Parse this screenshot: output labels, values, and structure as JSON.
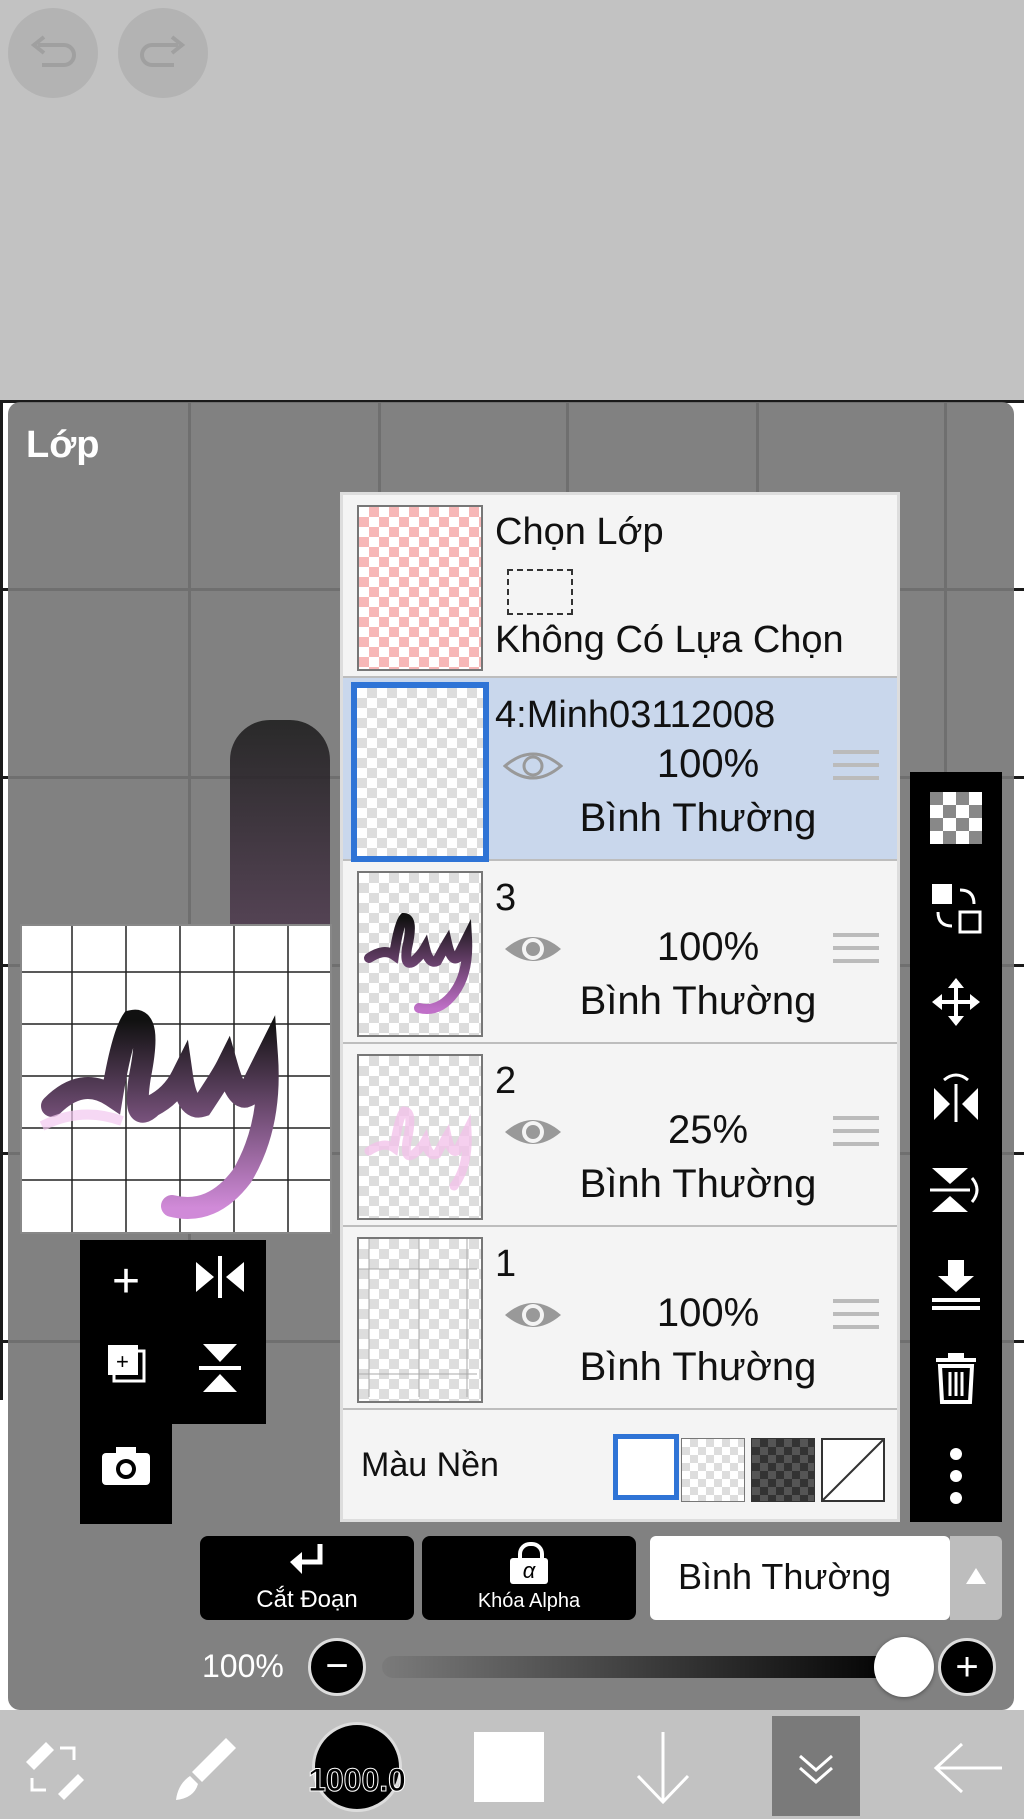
{
  "panel": {
    "title": "Lớp"
  },
  "selection_layer": {
    "title": "Chọn Lớp",
    "status": "Không Có Lựa Chọn"
  },
  "layers": [
    {
      "name": "4:Minh03112008",
      "opacity": "100%",
      "blend": "Bình Thường",
      "selected": true
    },
    {
      "name": "3",
      "opacity": "100%",
      "blend": "Bình Thường",
      "selected": false
    },
    {
      "name": "2",
      "opacity": "25%",
      "blend": "Bình Thường",
      "selected": false
    },
    {
      "name": "1",
      "opacity": "100%",
      "blend": "Bình Thường",
      "selected": false
    }
  ],
  "background": {
    "label": "Màu Nền"
  },
  "actions": {
    "clip_label": "Cắt Đoạn",
    "alpha_lock_label": "Khóa Alpha",
    "alpha_symbol": "α"
  },
  "blend_mode": {
    "value": "Bình Thường"
  },
  "opacity_slider": {
    "label": "100%",
    "value_fraction": 1.0
  },
  "bottom": {
    "brush_size": "1000.0"
  },
  "icons": {
    "undo": "undo-icon",
    "redo": "redo-icon",
    "add": "plus-icon",
    "camera": "camera-icon",
    "flip": "flip-icon",
    "trash": "trash-icon",
    "more": "more-vertical-icon"
  },
  "colors": {
    "accent": "#2f74d6",
    "selected_row": "#c9d7ec",
    "panel": "#767676"
  }
}
